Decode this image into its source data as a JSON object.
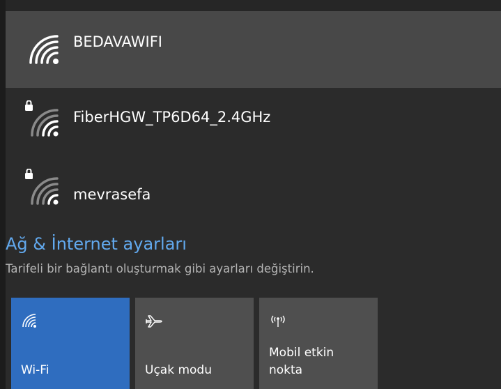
{
  "networks": [
    {
      "name": "BEDAVAWIFI",
      "secured": false,
      "selected": true
    },
    {
      "name": "FiberHGW_TP6D64_2.4GHz",
      "secured": true,
      "selected": false
    },
    {
      "name": "mevrasefa",
      "secured": true,
      "selected": false
    }
  ],
  "settings": {
    "link": "Ağ & İnternet ayarları",
    "description": "Tarifeli bir bağlantı oluşturmak gibi ayarları değiştirin."
  },
  "quick_actions": [
    {
      "line1": "Wi-Fi",
      "icon": "wifi-icon",
      "active": true
    },
    {
      "line1": "Uçak modu",
      "icon": "airplane-icon",
      "active": false
    },
    {
      "line1": "Mobil etkin",
      "line2": "nokta",
      "icon": "hotspot-icon",
      "active": false
    }
  ],
  "colors": {
    "accent_blue": "#2f6dbf",
    "link_blue": "#62a9ee",
    "tile_gray": "#4f4f4f",
    "selected_row": "#484848"
  }
}
